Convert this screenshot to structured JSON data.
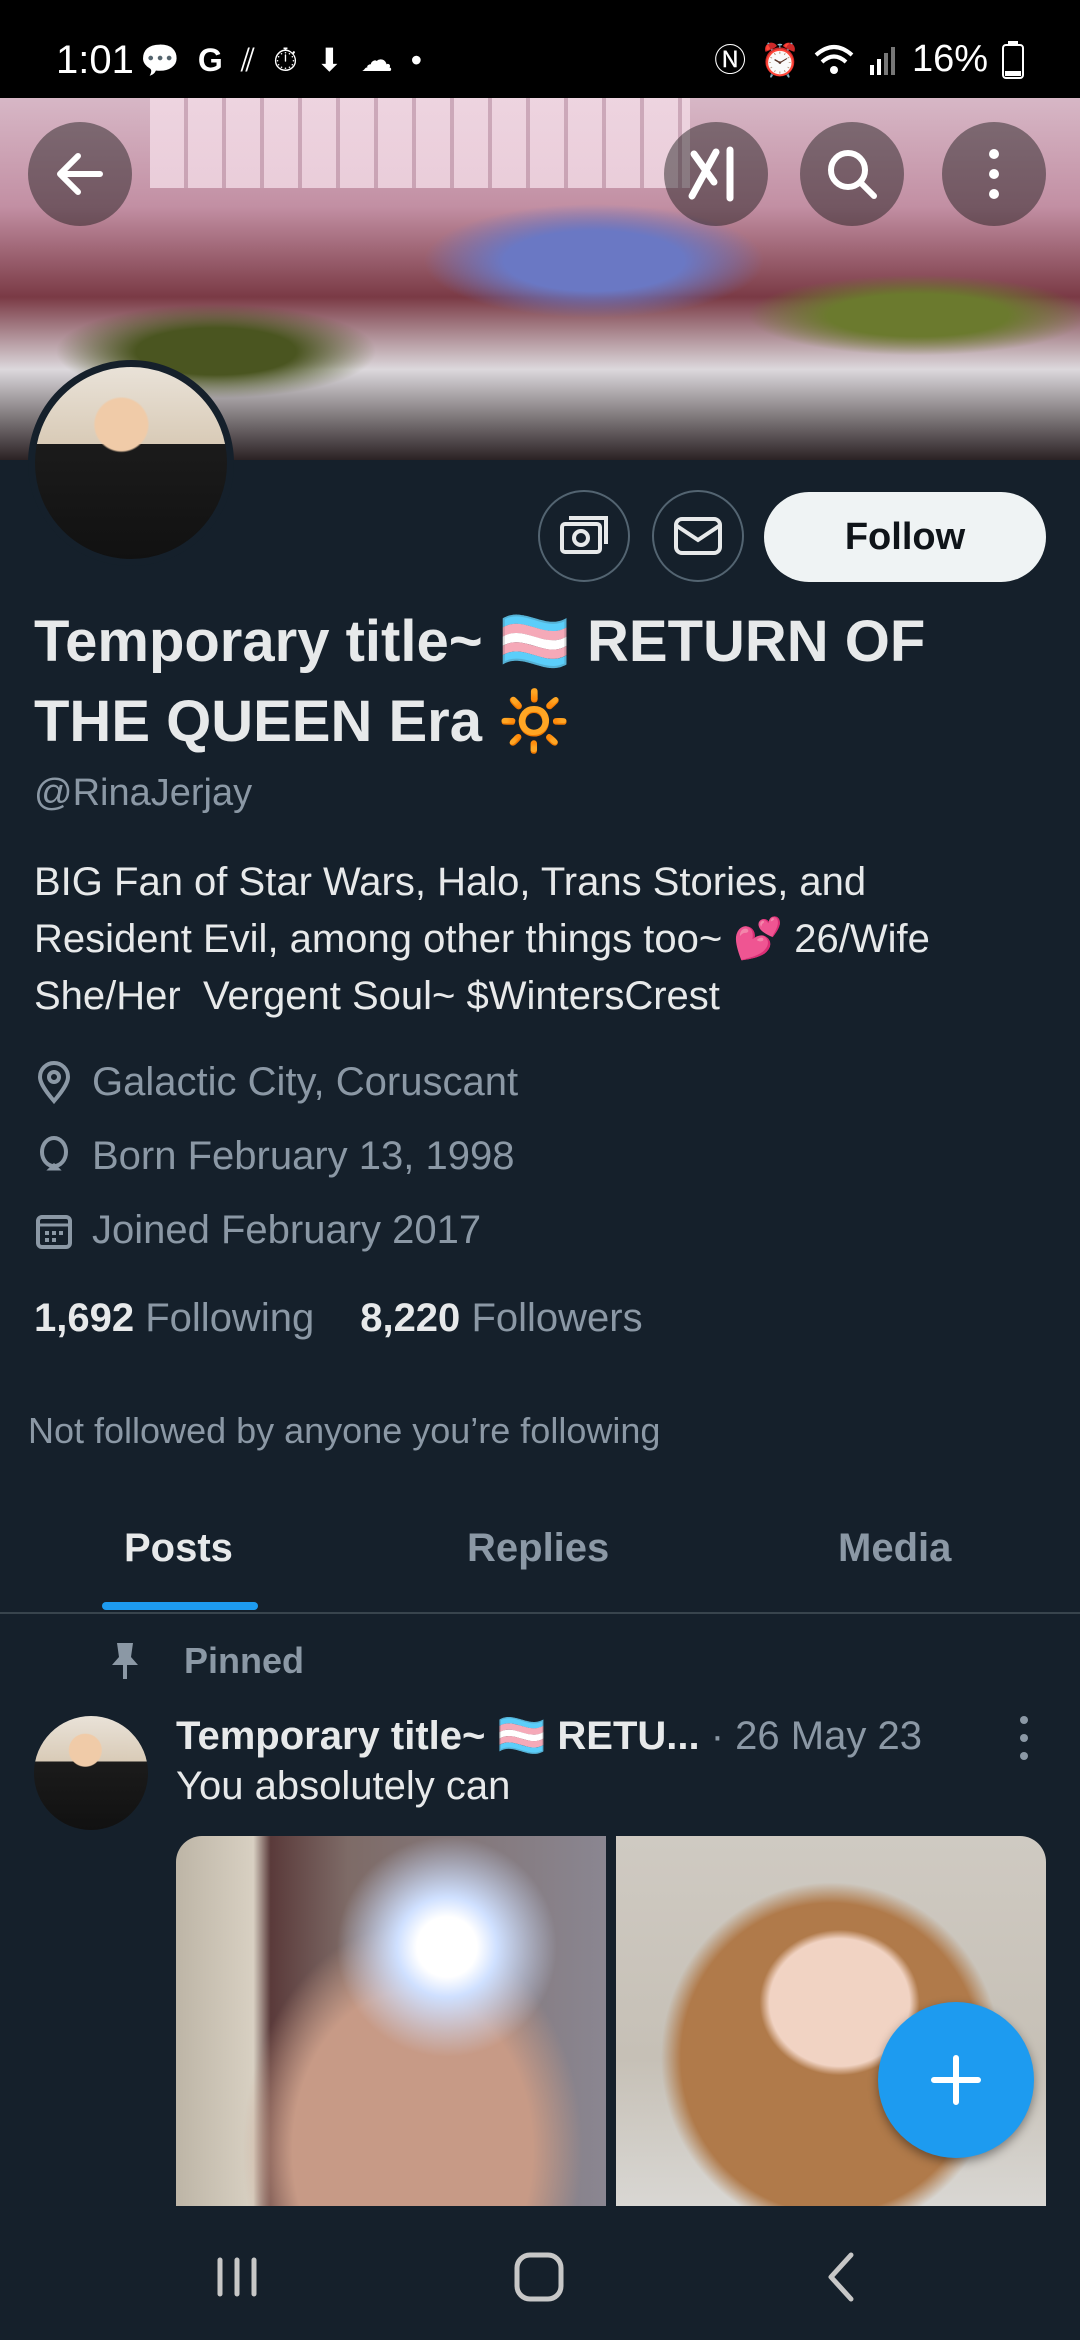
{
  "status_bar": {
    "time": "1:01",
    "battery": "16%",
    "left_icons": [
      "chat-bubble-icon",
      "google-icon",
      "signal-icon",
      "timer-icon",
      "location-icon",
      "cloud-icon",
      "dot-icon"
    ],
    "right_icons": [
      "nfc-icon",
      "alarm-icon",
      "wifi-icon",
      "cell-signal-icon",
      "battery-icon"
    ]
  },
  "header": {
    "back_icon": "arrow-left-icon",
    "grok_icon": "grok-icon",
    "search_icon": "search-icon",
    "more_icon": "more-vertical-icon"
  },
  "profile": {
    "name": "Temporary title~ 🏳️‍⚧️ RETURN OF THE QUEEN Era 🔆",
    "handle": "@RinaJerjay",
    "bio_line1": "BIG Fan of Star Wars, Halo, Trans Stories, and",
    "bio_line2": "Resident Evil, among other things too~ 💕 26/Wife",
    "bio_line3": "She/Her  Vergent Soul~ $WintersCrest",
    "location": "Galactic City, Coruscant",
    "birthday": "Born February 13, 1998",
    "joined": "Joined February 2017",
    "following_count": "1,692",
    "following_label": "Following",
    "followers_count": "8,220",
    "followers_label": "Followers",
    "not_followed": "Not followed by anyone you’re following",
    "follow_button": "Follow"
  },
  "tabs": [
    {
      "label": "Posts",
      "active": true
    },
    {
      "label": "Replies",
      "active": false
    },
    {
      "label": "Media",
      "active": false
    }
  ],
  "post": {
    "pinned_label": "Pinned",
    "author": "Temporary title~ 🏳️‍⚧️ RETU...",
    "date": " · 26 May 23",
    "text": "You absolutely can"
  },
  "colors": {
    "background": "#15202b",
    "accent": "#1d9bf0",
    "text_primary": "#e7e9ea",
    "text_secondary": "#8b98a5"
  }
}
